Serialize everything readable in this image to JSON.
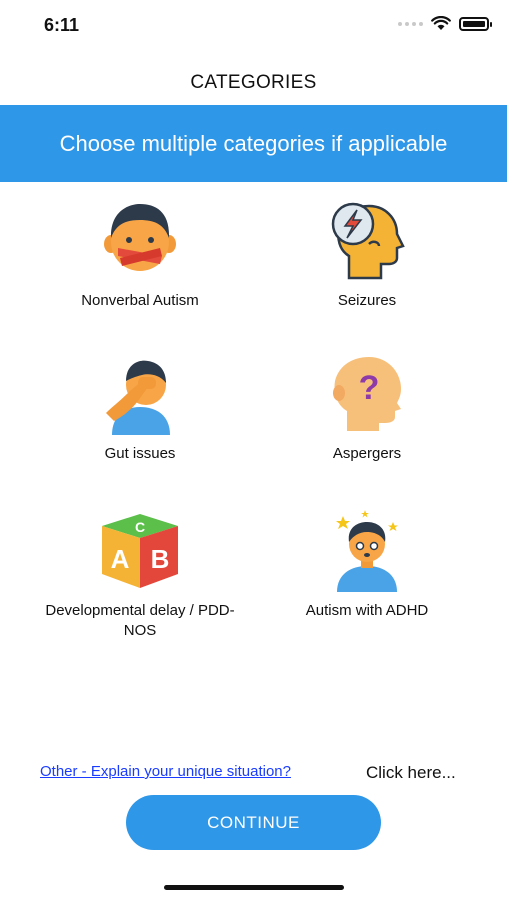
{
  "status": {
    "time": "6:11"
  },
  "page": {
    "title": "CATEGORIES"
  },
  "banner": {
    "text": "Choose multiple categories if applicable"
  },
  "categories": [
    {
      "label": "Nonverbal Autism",
      "icon": "nonverbal-face-icon"
    },
    {
      "label": "Seizures",
      "icon": "seizure-head-icon"
    },
    {
      "label": "Gut issues",
      "icon": "facepalm-person-icon"
    },
    {
      "label": "Aspergers",
      "icon": "question-head-icon"
    },
    {
      "label": "Developmental delay / PDD-NOS",
      "icon": "abc-block-icon"
    },
    {
      "label": "Autism with ADHD",
      "icon": "dizzy-person-icon"
    }
  ],
  "footer": {
    "other_link": "Other - Explain your unique situation?",
    "click_here": "Click here...",
    "continue_label": "CONTINUE"
  },
  "colors": {
    "accent": "#2e97e8",
    "link": "#1a3cff"
  }
}
